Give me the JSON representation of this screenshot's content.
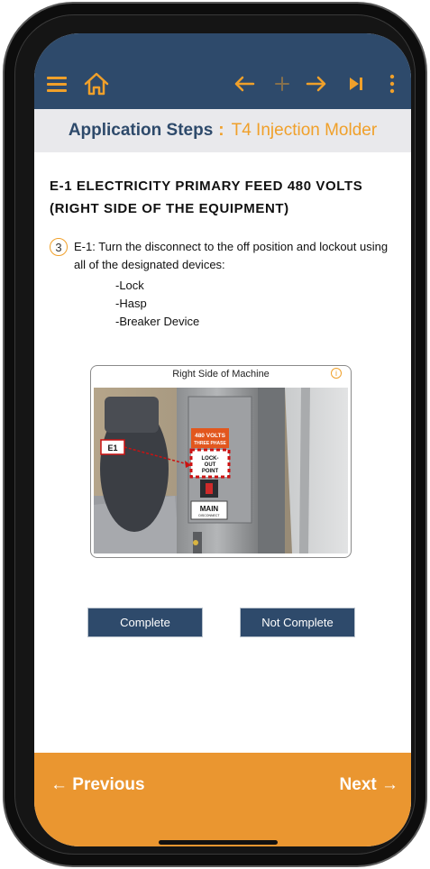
{
  "header": {
    "menu_icon": "hamburger-icon",
    "home_icon": "home-icon",
    "back_icon": "arrow-left-icon",
    "add_icon": "plus-icon",
    "forward_icon": "arrow-right-icon",
    "skip_icon": "skip-end-icon",
    "more_icon": "more-vertical-icon",
    "accent_color": "#f0a02a",
    "bar_color": "#2e4a6b"
  },
  "subheader": {
    "label": "Application Steps",
    "separator": ":",
    "value": "T4 Injection Molder"
  },
  "step": {
    "title": "E-1 ELECTRICITY PRIMARY FEED 480 VOLTS (RIGHT SIDE OF THE EQUIPMENT)",
    "number": "3",
    "instruction": "E-1: Turn the disconnect to the off position and lockout using all of the designated devices:",
    "devices": [
      "-Lock",
      "-Hasp",
      "-Breaker Device"
    ]
  },
  "photo": {
    "caption": "Right Side of Machine",
    "info_icon": "info-icon",
    "tag_label": "E1",
    "sign_voltage": "480 VOLTS",
    "sign_phase": "THREE PHASE",
    "lockout_label": "LOCK-\nOUT\nPOINT",
    "main_label": "MAIN",
    "main_sub": "DISCONNECT"
  },
  "actions": {
    "complete_label": "Complete",
    "not_complete_label": "Not Complete"
  },
  "footer": {
    "previous_label": "← Previous",
    "next_label": "Next →",
    "footer_color": "#ea9630"
  }
}
